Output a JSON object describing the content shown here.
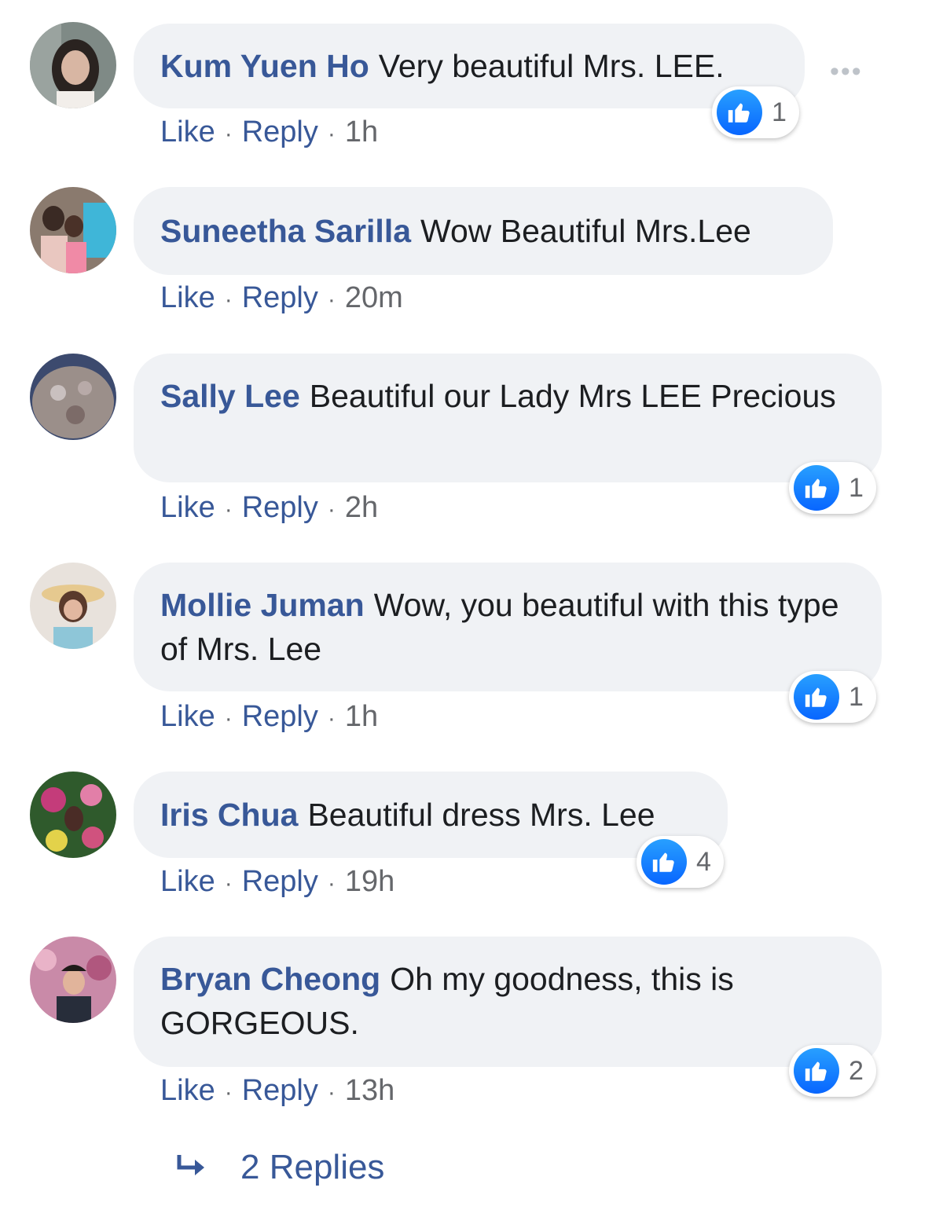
{
  "comments": [
    {
      "author": "Kum Yuen Ho",
      "text": "Very beautiful Mrs. LEE.",
      "like": "Like",
      "reply": "Reply",
      "time": "1h",
      "reactions": "1"
    },
    {
      "author": "Suneetha Sarilla",
      "text": "Wow Beautiful Mrs.Lee",
      "like": "Like",
      "reply": "Reply",
      "time": "20m",
      "reactions": ""
    },
    {
      "author": "Sally Lee",
      "text": "Beautiful our Lady Mrs LEE Precious",
      "like": "Like",
      "reply": "Reply",
      "time": "2h",
      "reactions": "1"
    },
    {
      "author": "Mollie Juman",
      "text": "Wow, you beautiful with this type of Mrs. Lee",
      "like": "Like",
      "reply": "Reply",
      "time": "1h",
      "reactions": "1"
    },
    {
      "author": "Iris Chua",
      "text": "Beautiful dress Mrs. Lee",
      "like": "Like",
      "reply": "Reply",
      "time": "19h",
      "reactions": "4"
    },
    {
      "author": "Bryan Cheong",
      "text": "Oh my goodness, this is GORGEOUS.",
      "like": "Like",
      "reply": "Reply",
      "time": "13h",
      "reactions": "2"
    }
  ],
  "more_options": "•••",
  "view_replies": "2 Replies",
  "icons": {
    "reaction": "like-icon",
    "more": "more-options-icon",
    "replies": "reply-arrow-icon"
  },
  "colors": {
    "author": "#385898",
    "bubble": "#f0f2f5",
    "like_blue": "#1877f2"
  }
}
